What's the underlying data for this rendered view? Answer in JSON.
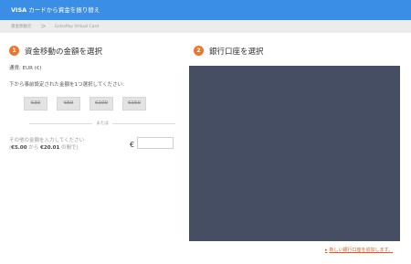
{
  "header": {
    "brand": "VISA",
    "title_rest": " カードから資金を振り替え"
  },
  "breadcrumb": {
    "item1": "資金移動元",
    "separator": ">",
    "item2": "EntroPay Virtual Card"
  },
  "step1": {
    "number": "1",
    "title": "資金移動の金額を選択",
    "currency": "通貨: EUR (€)",
    "select_hint": "下から事前設定された金額を1つ選択してください:",
    "amounts": [
      "€30",
      "€50",
      "€100",
      "€150"
    ],
    "or_label": "または",
    "other_label": "その他の金額を入力してください",
    "range_prefix": "(",
    "range_min": "€5.00",
    "range_mid": " から ",
    "range_max": "€20.01",
    "range_suffix": " の間で)",
    "euro_symbol": "€",
    "amount_input_value": ""
  },
  "step2": {
    "number": "2",
    "title": "銀行口座を選択"
  },
  "footer": {
    "new_account_link": "新しい銀行口座を追加します。",
    "arrow": "▸"
  },
  "colors": {
    "header_blue": "#3a8ee6",
    "step_orange": "#f0752a",
    "panel_slate": "#454e63",
    "link_orange": "#e05b22"
  }
}
